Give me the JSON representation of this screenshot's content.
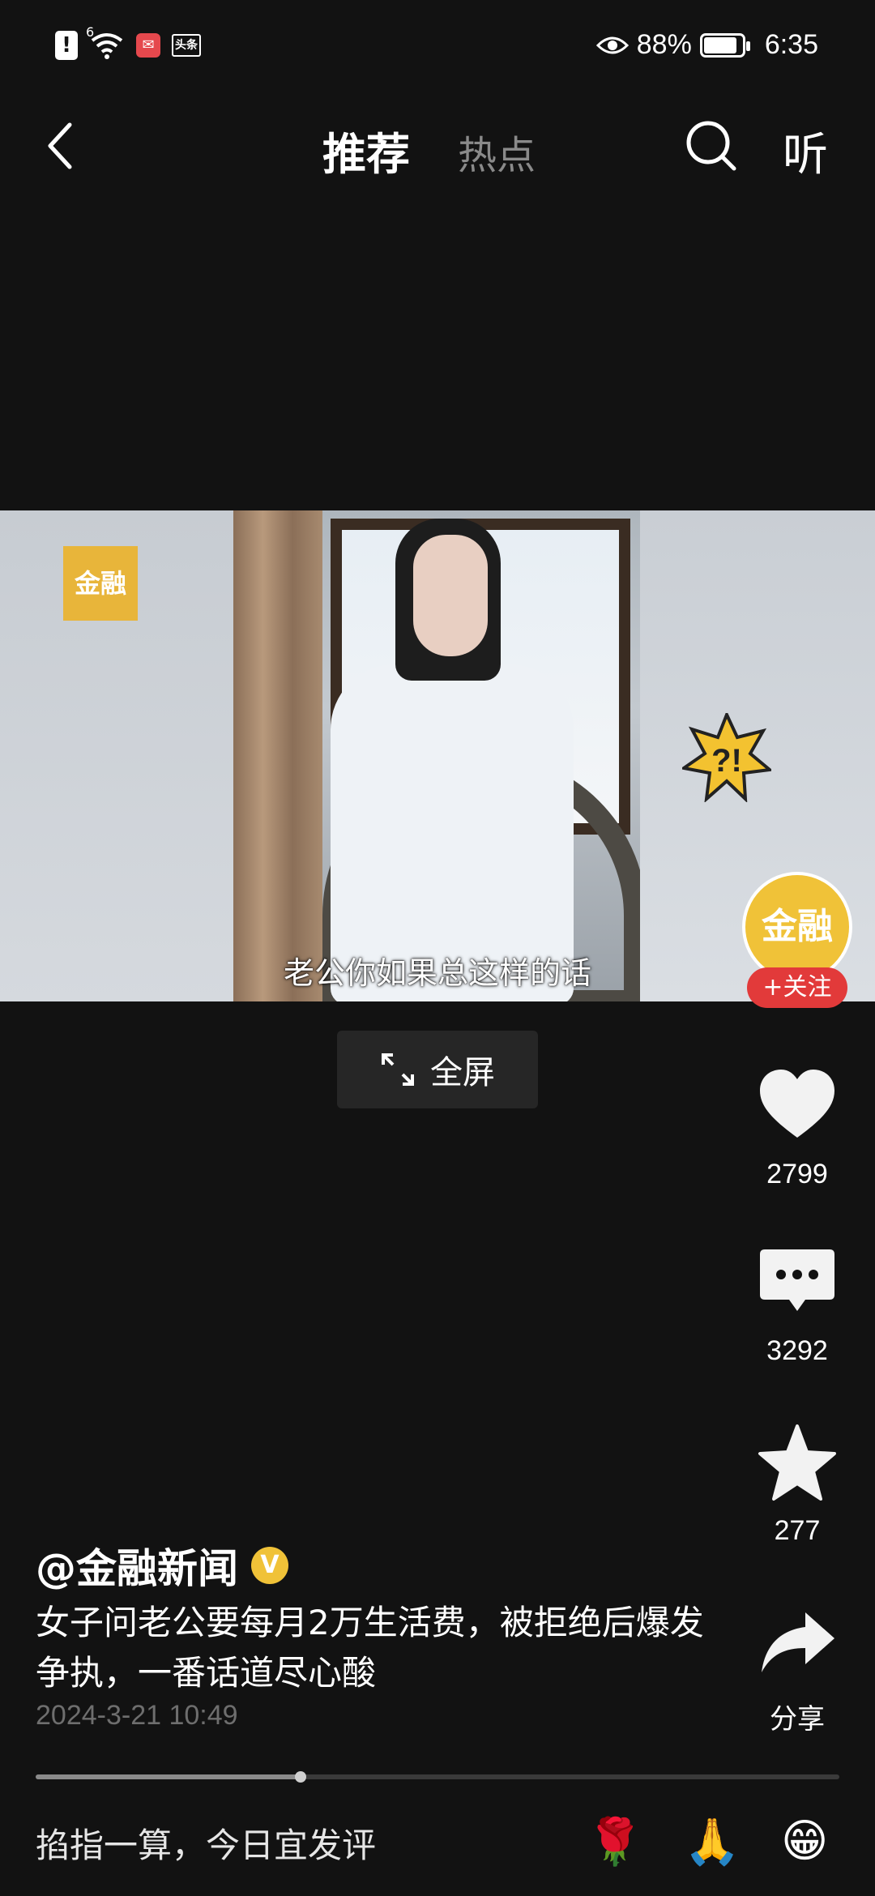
{
  "status_bar": {
    "alert": "!",
    "wifi_label": "6",
    "toutiao": "头条",
    "battery_percent": "88%",
    "battery_level": 0.88,
    "time": "6:35"
  },
  "nav": {
    "tab_active": "推荐",
    "tab_inactive": "热点",
    "listen": "听"
  },
  "video": {
    "caption": "老公你如果总这样的话",
    "logo_text": "金融"
  },
  "fullscreen": {
    "label": "全屏"
  },
  "rail": {
    "avatar_text": "金融",
    "follow": "+关注",
    "likes": "2799",
    "comments": "3292",
    "favorites": "277",
    "share": "分享"
  },
  "post": {
    "author": "@金融新闻",
    "verified_badge": "V",
    "description": "女子问老公要每月2万生活费，被拒绝后爆发争执，一番话道尽心酸",
    "time": "2024-3-21 10:49",
    "progress": 0.33
  },
  "comment_bar": {
    "placeholder": "掐指一算，今日宜发评",
    "emojis": [
      "🌹",
      "🙏",
      "😁"
    ]
  }
}
